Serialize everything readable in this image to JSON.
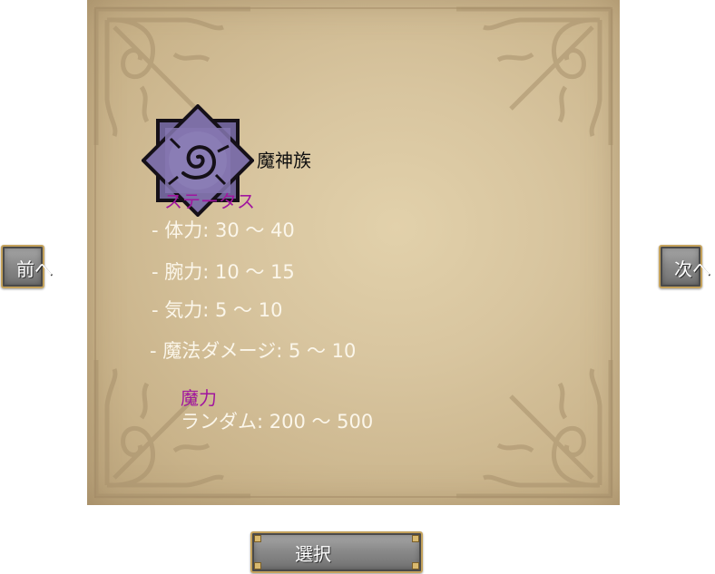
{
  "race": {
    "icon": "spiral-emblem-icon",
    "name": "魔神族"
  },
  "status": {
    "heading": "ステータス",
    "stats": [
      "- 体力: 30 ～ 40",
      "- 腕力: 10 ～ 15",
      "- 気力: 5 ～ 10",
      "- 魔法ダメージ: 5 ～ 10"
    ]
  },
  "magic": {
    "heading": "魔力",
    "value": "ランダム: 200 ～ 500"
  },
  "nav": {
    "prev_label": "前へ",
    "next_label": "次へ"
  },
  "select_label": "選択",
  "colors": {
    "heading": "#a1169e",
    "stat_text": "#fbf6ea",
    "emblem": "#7d6fa6",
    "button_border": "#c4a25c"
  }
}
